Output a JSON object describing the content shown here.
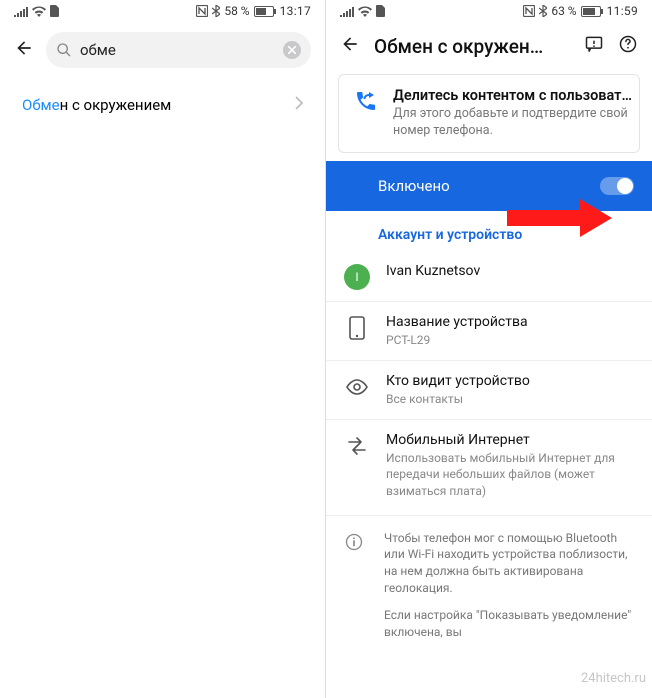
{
  "left": {
    "status": {
      "battery_pct": "58 %",
      "time": "13:17"
    },
    "search": {
      "query": "обме"
    },
    "result": {
      "highlight": "Обме",
      "rest": "н с окружением"
    }
  },
  "right": {
    "status": {
      "battery_pct": "63 %",
      "time": "11:59"
    },
    "title": "Обмен с окружен…",
    "card": {
      "title": "Делитесь контентом с пользоват…",
      "sub": "Для этого добавьте и подтвердите свой номер телефона."
    },
    "toggle": {
      "label": "Включено",
      "on": true
    },
    "section_label": "Аккаунт и устройство",
    "settings": {
      "account": {
        "name": "Ivan Kuznetsov",
        "initial": "I"
      },
      "device_name": {
        "title": "Название устройства",
        "value": "PCT-L29"
      },
      "visibility": {
        "title": "Кто видит устройство",
        "value": "Все контакты"
      },
      "mobile_data": {
        "title": "Мобильный Интернет",
        "value": "Использовать мобильный Интернет для передачи небольших файлов (может взиматься плата)"
      }
    },
    "info": {
      "p1": "Чтобы телефон мог с помощью Bluetooth или Wi-Fi находить устройства поблизости, на нем должна быть активирована геолокация.",
      "p2": "Если настройка \"Показывать уведомление\" включена, вы"
    }
  },
  "watermark": "24hitech.ru"
}
